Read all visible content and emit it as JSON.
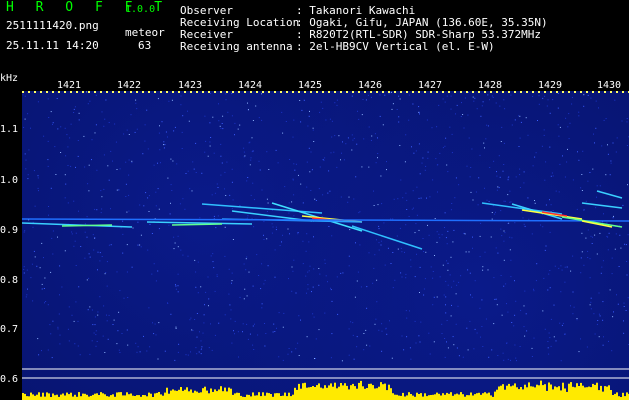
{
  "header": {
    "app_name": "H R O F F T",
    "version": "1.0.0",
    "filename": "2511111420.png",
    "datetime": "25.11.11 14:20",
    "meteor_label": "meteor",
    "meteor_count": "63"
  },
  "info": [
    {
      "key": "Observer",
      "value": ": Takanori Kawachi"
    },
    {
      "key": "Receiving Location",
      "value": ": Ogaki, Gifu, JAPAN (136.60E, 35.35N)"
    },
    {
      "key": "Receiver",
      "value": ": R820T2(RTL-SDR) SDR-Sharp 53.372MHz"
    },
    {
      "key": "Receiving antenna",
      "value": ": 2el-HB9CV Vertical (el. E-W)"
    }
  ],
  "axis": {
    "y_unit": "kHz",
    "y_ticks": [
      "1.1",
      "1.0",
      "0.9",
      "0.8",
      "0.7",
      "0.6"
    ],
    "x_ticks": [
      "1421",
      "1422",
      "1423",
      "1424",
      "1425",
      "1426",
      "1427",
      "1428",
      "1429",
      "1430"
    ]
  },
  "colors": {
    "background": "#000000",
    "spectrogram": "#071470",
    "accent": "#00ff00",
    "signal": "#ffff00",
    "hot": "#ff3030"
  }
}
